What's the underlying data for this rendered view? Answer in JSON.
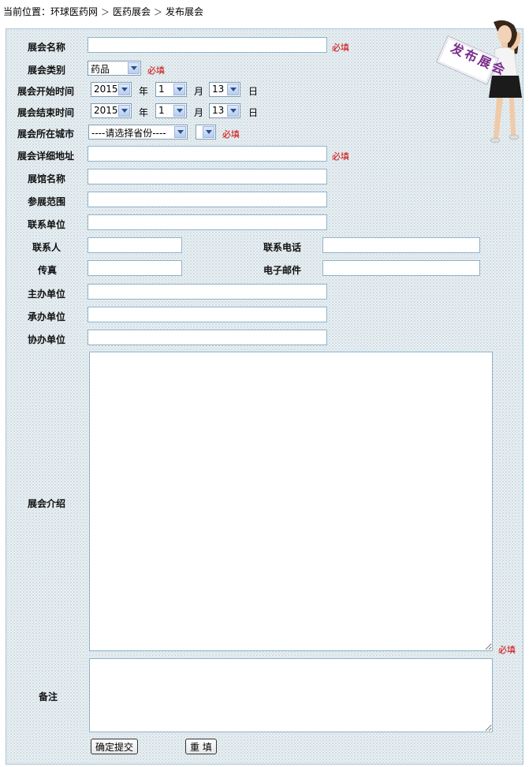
{
  "breadcrumb": {
    "prefix": "当前位置：",
    "items": [
      "环球医药网",
      "医药展会",
      "发布展会"
    ],
    "separator": "＞"
  },
  "banner": {
    "text": "发布展会"
  },
  "form": {
    "required_text": "必填",
    "name_label": "展会名称",
    "category_label": "展会类别",
    "category_value": "药品",
    "start_label": "展会开始时间",
    "end_label": "展会结束时间",
    "year_unit": "年",
    "month_unit": "月",
    "day_unit": "日",
    "start_year": "2015",
    "start_month": "1",
    "start_day": "13",
    "end_year": "2015",
    "end_month": "1",
    "end_day": "13",
    "city_label": "展会所在城市",
    "province_value": "----请选择省份----",
    "city_value": "",
    "address_label": "展会详细地址",
    "venue_label": "展馆名称",
    "scope_label": "参展范围",
    "contact_unit_label": "联系单位",
    "contact_person_label": "联系人",
    "phone_label": "联系电话",
    "fax_label": "传真",
    "email_label": "电子邮件",
    "organizer_label": "主办单位",
    "undertaker_label": "承办单位",
    "co_organizer_label": "协办单位",
    "intro_label": "展会介绍",
    "remarks_label": "备注",
    "submit_label": "确定提交",
    "reset_label": "重 填"
  },
  "colors": {
    "required": "#cc0000",
    "field_border": "#8fb3cd",
    "banner_text": "#7a2d8c"
  }
}
